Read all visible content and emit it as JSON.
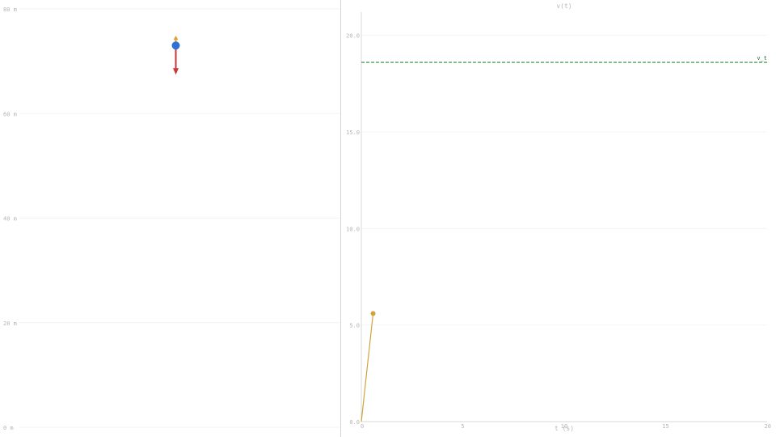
{
  "scene": {
    "height_unit": "m",
    "height_ticks": [
      {
        "value": 80,
        "label": "80 m"
      },
      {
        "value": 60,
        "label": "60 m"
      },
      {
        "value": 40,
        "label": "40 m"
      },
      {
        "value": 20,
        "label": "20 m"
      },
      {
        "value": 0,
        "label": "0 m"
      }
    ],
    "height_range": [
      0,
      80
    ],
    "ball_height": 73,
    "ball_color": "#2f6fd6",
    "force_arrow_up_color": "#e0a028",
    "force_arrow_down_color": "#c43a3a"
  },
  "chart_data": {
    "type": "line",
    "title": "v(t)",
    "xlabel": "t (s)",
    "ylabel": "",
    "xlim": [
      0,
      20
    ],
    "ylim": [
      0,
      21.2
    ],
    "x_ticks": [
      {
        "value": 0,
        "label": "0"
      },
      {
        "value": 5,
        "label": "5"
      },
      {
        "value": 10,
        "label": "10"
      },
      {
        "value": 15,
        "label": "15"
      },
      {
        "value": 20,
        "label": "20"
      }
    ],
    "y_ticks": [
      {
        "value": 0,
        "label": "0.0"
      },
      {
        "value": 5,
        "label": "5.0"
      },
      {
        "value": 10,
        "label": "10.0"
      },
      {
        "value": 15,
        "label": "15.0"
      },
      {
        "value": 20,
        "label": "20.0"
      }
    ],
    "series": [
      {
        "x": [
          0,
          0.58
        ],
        "y": [
          0,
          5.6
        ],
        "color": "#d4a23c"
      }
    ],
    "reference_lines": [
      {
        "label": "v_t",
        "y": 18.6,
        "color": "#2e8b3a"
      }
    ],
    "grid": true
  }
}
